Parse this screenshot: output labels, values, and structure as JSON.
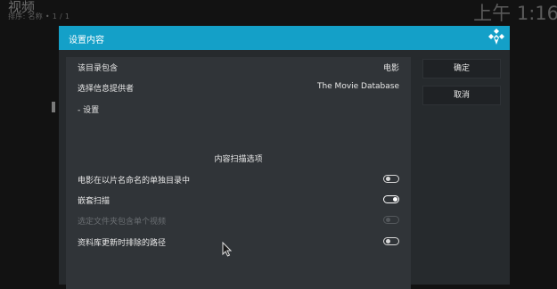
{
  "background": {
    "title": "视频",
    "sort_info": "排序: 名称  •  1 / 1",
    "clock": "上午 1:16"
  },
  "dialog": {
    "title": "设置内容",
    "rows": [
      {
        "label": "该目录包含",
        "value": "电影"
      },
      {
        "label": "选择信息提供者",
        "value": "The Movie Database"
      },
      {
        "label": "- 设置",
        "value": ""
      }
    ],
    "section_header": "内容扫描选项",
    "toggles": [
      {
        "label": "电影在以片名命名的单独目录中",
        "state": "off",
        "enabled": true
      },
      {
        "label": "嵌套扫描",
        "state": "on",
        "enabled": true
      },
      {
        "label": "选定文件夹包含单个视频",
        "state": "off",
        "enabled": false
      },
      {
        "label": "资料库更新时排除的路径",
        "state": "off",
        "enabled": true
      }
    ],
    "buttons": {
      "ok": "确定",
      "cancel": "取消"
    }
  },
  "colors": {
    "header": "#14a0c8",
    "dialog_bg": "#262a2d",
    "panel_bg": "#303438"
  },
  "icons": {
    "logo": "kodi-logo-icon",
    "cursor": "mouse-pointer-icon"
  }
}
